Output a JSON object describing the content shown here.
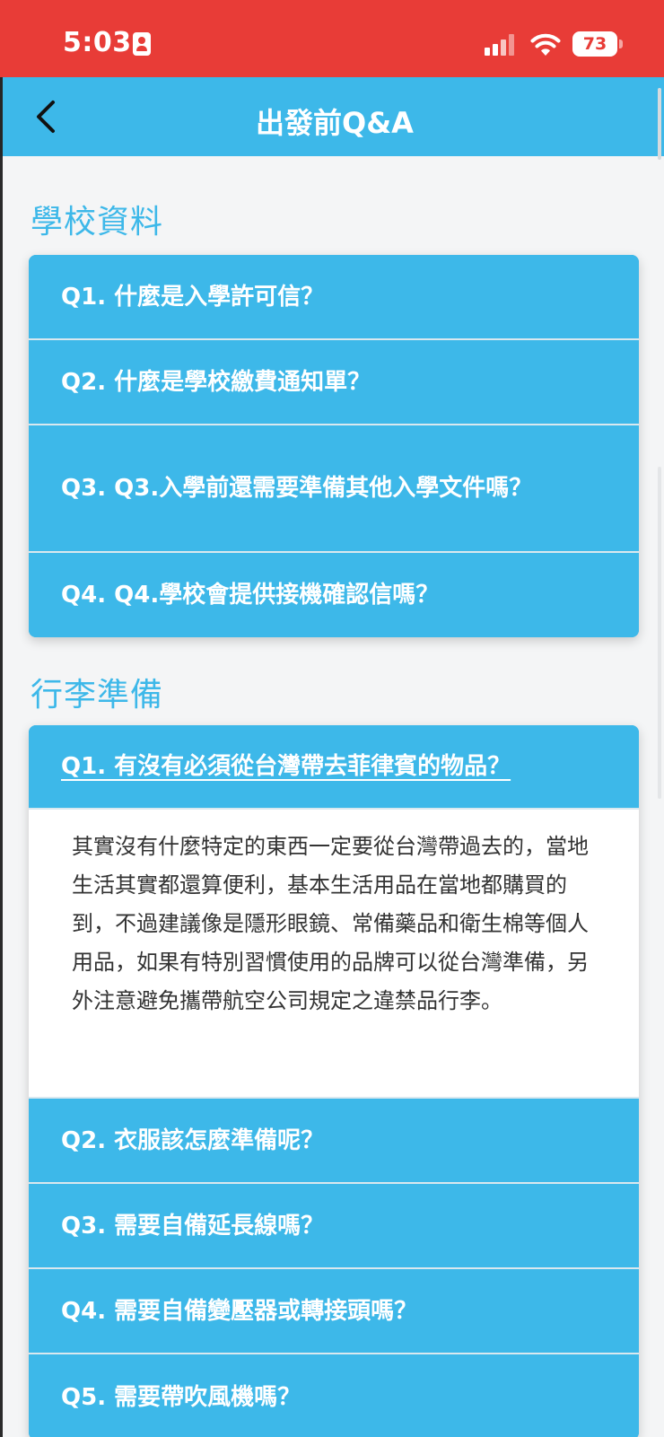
{
  "status": {
    "time": "5:03",
    "battery": "73"
  },
  "header": {
    "title": "出發前Q&A"
  },
  "sections": [
    {
      "title": "學校資料",
      "items": [
        {
          "label": "Q1. 什麼是入學許可信？"
        },
        {
          "label": "Q2. 什麼是學校繳費通知單？"
        },
        {
          "label": "Q3. Q3.入學前還需要準備其他入學文件嗎？"
        },
        {
          "label": "Q4. Q4.學校會提供接機確認信嗎？"
        }
      ]
    },
    {
      "title": "行李準備",
      "items": [
        {
          "label": "Q1. 有沒有必須從台灣帶去菲律賓的物品？",
          "expanded": true,
          "answer": "其實沒有什麼特定的東西一定要從台灣帶過去的，當地生活其實都還算便利，基本生活用品在當地都購買的到，不過建議像是隱形眼鏡、常備藥品和衛生棉等個人用品，如果有特別習慣使用的品牌可以從台灣準備，另外注意避免攜帶航空公司規定之違禁品行李。"
        },
        {
          "label": "Q2. 衣服該怎麼準備呢？"
        },
        {
          "label": "Q3. 需要自備延長線嗎？"
        },
        {
          "label": "Q4. 需要自備變壓器或轉接頭嗎？"
        },
        {
          "label": "Q5. 需要帶吹風機嗎？"
        }
      ]
    }
  ]
}
